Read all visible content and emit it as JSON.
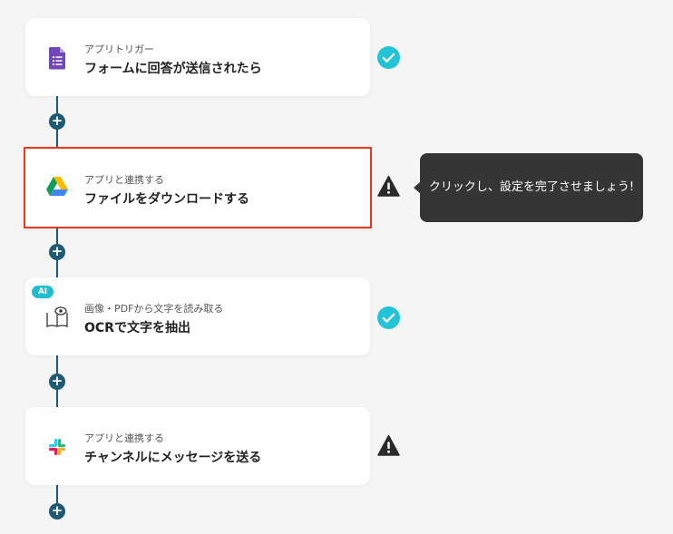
{
  "steps": [
    {
      "sub": "アプリトリガー",
      "main": "フォームに回答が送信されたら",
      "icon": "google-forms-icon",
      "status": "check"
    },
    {
      "sub": "アプリと連携する",
      "main": "ファイルをダウンロードする",
      "icon": "google-drive-icon",
      "status": "warning"
    },
    {
      "sub": "画像・PDFから文字を読み取る",
      "main": "OCRで文字を抽出",
      "icon": "ocr-book-eye-icon",
      "status": "check",
      "badge": "AI"
    },
    {
      "sub": "アプリと連携する",
      "main": "チャンネルにメッセージを送る",
      "icon": "slack-icon",
      "status": "warning"
    }
  ],
  "tooltip": "クリックし、設定を完了させましょう!",
  "colors": {
    "connector": "#1e5a72",
    "check": "#22c3d6",
    "warning": "#2a2a2a",
    "selected_border": "#e8381d"
  }
}
